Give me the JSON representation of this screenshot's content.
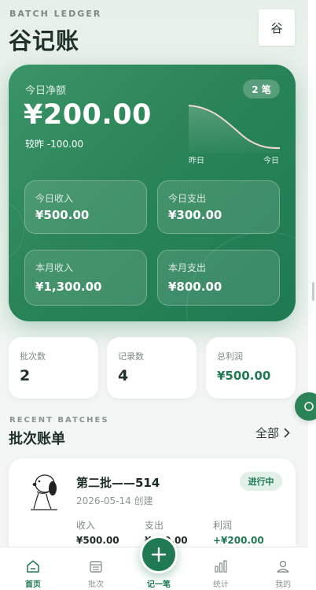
{
  "header": {
    "eyebrow": "BATCH LEDGER",
    "title": "谷记账",
    "avatar_text": "谷"
  },
  "today": {
    "label": "今日净额",
    "count_badge": "2 笔",
    "net_amount": "¥200.00",
    "compare_prefix": "较昨",
    "compare_value": "-100.00",
    "trend_labels": {
      "start": "昨日",
      "end": "今日"
    },
    "tiles": [
      {
        "label": "今日收入",
        "value": "¥500.00"
      },
      {
        "label": "今日支出",
        "value": "¥300.00"
      },
      {
        "label": "本月收入",
        "value": "¥1,300.00"
      },
      {
        "label": "本月支出",
        "value": "¥800.00"
      }
    ]
  },
  "summary": [
    {
      "label": "批次数",
      "value": "2"
    },
    {
      "label": "记录数",
      "value": "4"
    },
    {
      "label": "总利润",
      "value": "¥500.00"
    }
  ],
  "recent": {
    "eyebrow": "RECENT BATCHES",
    "title": "批次账单",
    "see_all": "全部",
    "batches": [
      {
        "name": "第二批——514",
        "date": "2026-05-14 创建",
        "status": "进行中",
        "income_label": "收入",
        "income_value": "¥500.00",
        "expense_label": "支出",
        "expense_value": "¥300.00",
        "profit_label": "利润",
        "profit_value": "+¥200.00"
      }
    ]
  },
  "tabbar": {
    "items": [
      {
        "label": "首页",
        "icon": "home-icon"
      },
      {
        "label": "批次",
        "icon": "calendar-icon"
      },
      {
        "label": "记一笔",
        "icon": "plus-icon"
      },
      {
        "label": "统计",
        "icon": "bar-chart-icon"
      },
      {
        "label": "我的",
        "icon": "user-icon"
      }
    ]
  },
  "colors": {
    "brand": "#1f7a52",
    "brand_light": "#e1f1e7",
    "text_primary": "#1c2b25",
    "text_muted": "#8a968f"
  }
}
